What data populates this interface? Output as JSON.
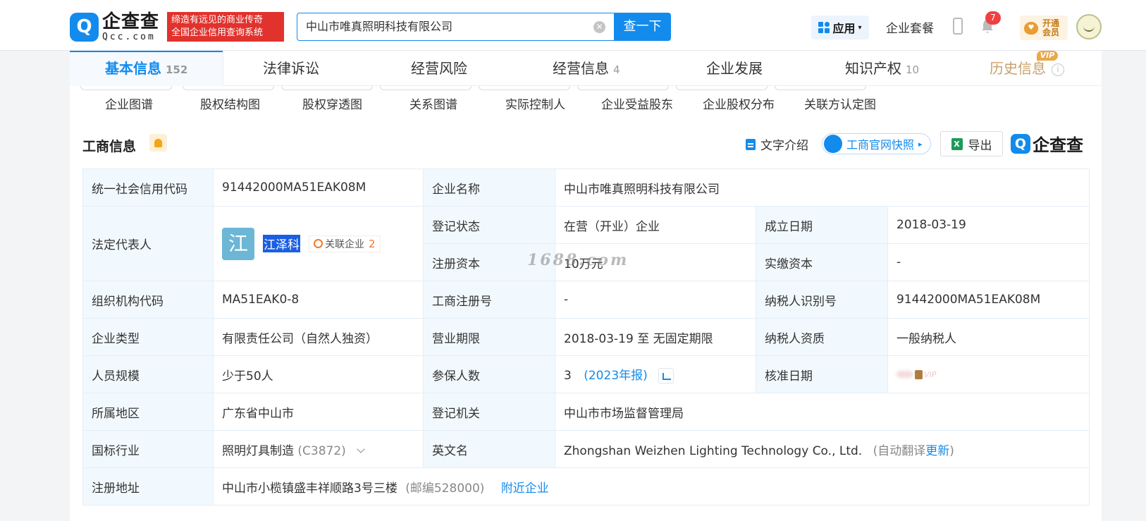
{
  "header": {
    "logo_text": "企查查",
    "logo_sub": "Qcc.com",
    "slogan_line1": "缔造有远见的商业传奇",
    "slogan_line2": "全国企业信用查询系统",
    "search_value": "中山市唯真照明科技有限公司",
    "search_button": "查一下",
    "app_label": "应用",
    "package_label": "企业套餐",
    "notification_count": "7",
    "vip_line1": "开通",
    "vip_line2": "会员"
  },
  "tabs": [
    {
      "label": "基本信息",
      "count": "152"
    },
    {
      "label": "法律诉讼",
      "count": ""
    },
    {
      "label": "经营风险",
      "count": ""
    },
    {
      "label": "经营信息",
      "count": "4"
    },
    {
      "label": "企业发展",
      "count": ""
    },
    {
      "label": "知识产权",
      "count": "10"
    },
    {
      "label": "历史信息",
      "count": ""
    }
  ],
  "vip_tag": "VIP",
  "subtabs": [
    "企业图谱",
    "股权结构图",
    "股权穿透图",
    "关系图谱",
    "实际控制人",
    "企业受益股东",
    "企业股权分布",
    "关联方认定图"
  ],
  "section": {
    "title": "工商信息",
    "text_intro": "文字介绍",
    "gs_snapshot": "工商官网快照",
    "export": "导出",
    "brand": "企查查"
  },
  "info": {
    "credit_code_label": "统一社会信用代码",
    "credit_code": "91442000MA51EAK08M",
    "company_name_label": "企业名称",
    "company_name": "中山市唯真照明科技有限公司",
    "legal_rep_label": "法定代表人",
    "legal_rep_avatar": "江",
    "legal_rep_name": "江泽科",
    "related_label": "关联企业",
    "related_count": "2",
    "reg_status_label": "登记状态",
    "reg_status": "在营（开业）企业",
    "found_date_label": "成立日期",
    "found_date": "2018-03-19",
    "reg_capital_label": "注册资本",
    "reg_capital": "10万元",
    "paid_capital_label": "实缴资本",
    "paid_capital": "-",
    "org_code_label": "组织机构代码",
    "org_code": "MA51EAK0-8",
    "biz_reg_no_label": "工商注册号",
    "biz_reg_no": "-",
    "taxpayer_id_label": "纳税人识别号",
    "taxpayer_id": "91442000MA51EAK08M",
    "company_type_label": "企业类型",
    "company_type": "有限责任公司（自然人独资）",
    "biz_term_label": "营业期限",
    "biz_term": "2018-03-19 至 无固定期限",
    "taxpayer_qual_label": "纳税人资质",
    "taxpayer_qual": "一般纳税人",
    "staff_size_label": "人员规模",
    "staff_size": "少于50人",
    "insured_label": "参保人数",
    "insured_count": "3",
    "insured_year": "(2023年报)",
    "approve_date_label": "核准日期",
    "approve_vip": "VIP",
    "region_label": "所属地区",
    "region": "广东省中山市",
    "reg_authority_label": "登记机关",
    "reg_authority": "中山市市场监督管理局",
    "industry_label": "国标行业",
    "industry": "照明灯具制造",
    "industry_code": "(C3872)",
    "english_name_label": "英文名",
    "english_name": "Zhongshan Weizhen Lighting Technology Co., Ltd.",
    "auto_translate": "(自动翻译",
    "update": "更新",
    "close_paren": ")",
    "address_label": "注册地址",
    "address": "中山市小榄镇盛丰祥顺路3号三楼",
    "postcode": "(邮编528000)",
    "nearby": "附近企业"
  },
  "watermark": "1688.com",
  "colors": {
    "accent": "#128bed",
    "slogan_bg": "#e1322d",
    "label_bg": "#f2f9fe"
  }
}
